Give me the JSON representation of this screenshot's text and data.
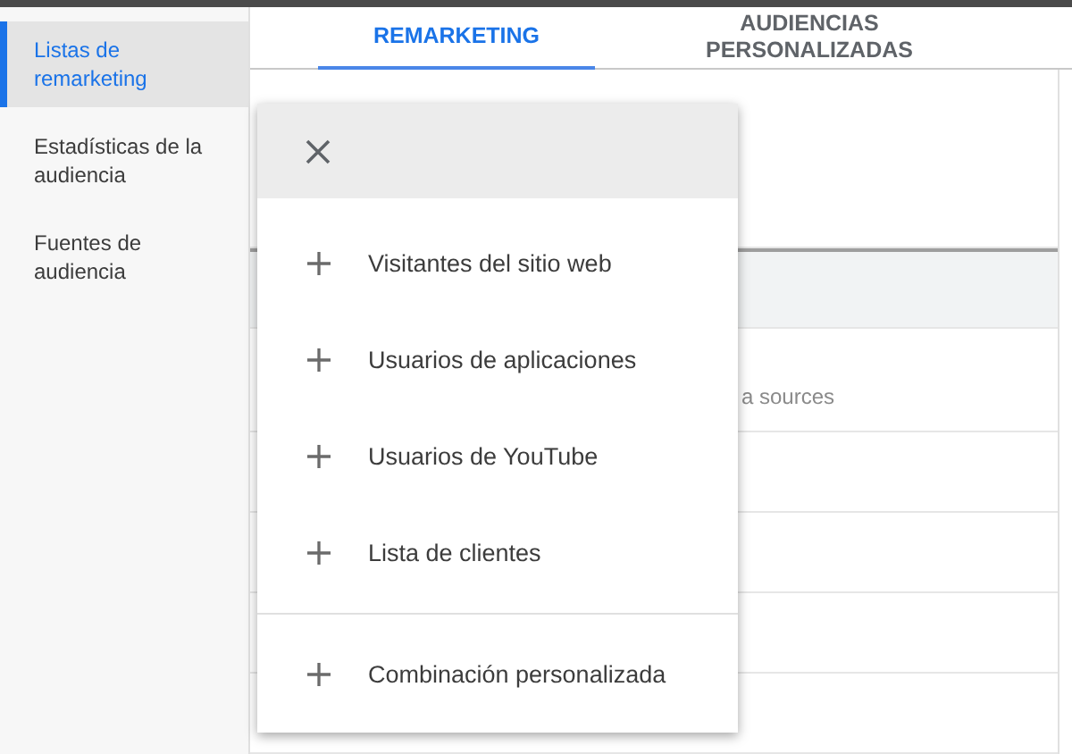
{
  "sidebar": {
    "items": [
      {
        "label": "Listas de remarketing",
        "selected": true
      },
      {
        "label": "Estadísticas de la audiencia",
        "selected": false
      },
      {
        "label": "Fuentes de audiencia",
        "selected": false
      }
    ]
  },
  "tabs": [
    {
      "label": "REMARKETING",
      "selected": true
    },
    {
      "label": "AUDIENCIAS PERSONALIZADAS",
      "selected": false
    }
  ],
  "table": {
    "rows": [
      {
        "kind": "plain"
      },
      {
        "kind": "header"
      },
      {
        "kind": "plain",
        "text": "a sources"
      },
      {
        "kind": "plain"
      },
      {
        "kind": "plain"
      },
      {
        "kind": "plain"
      },
      {
        "kind": "plain"
      }
    ]
  },
  "menu": {
    "sections": [
      {
        "items": [
          {
            "label": "Visitantes del sitio web"
          },
          {
            "label": "Usuarios de aplicaciones"
          },
          {
            "label": "Usuarios de YouTube"
          },
          {
            "label": "Lista de clientes"
          }
        ]
      },
      {
        "items": [
          {
            "label": "Combinación personalizada"
          }
        ]
      }
    ]
  }
}
